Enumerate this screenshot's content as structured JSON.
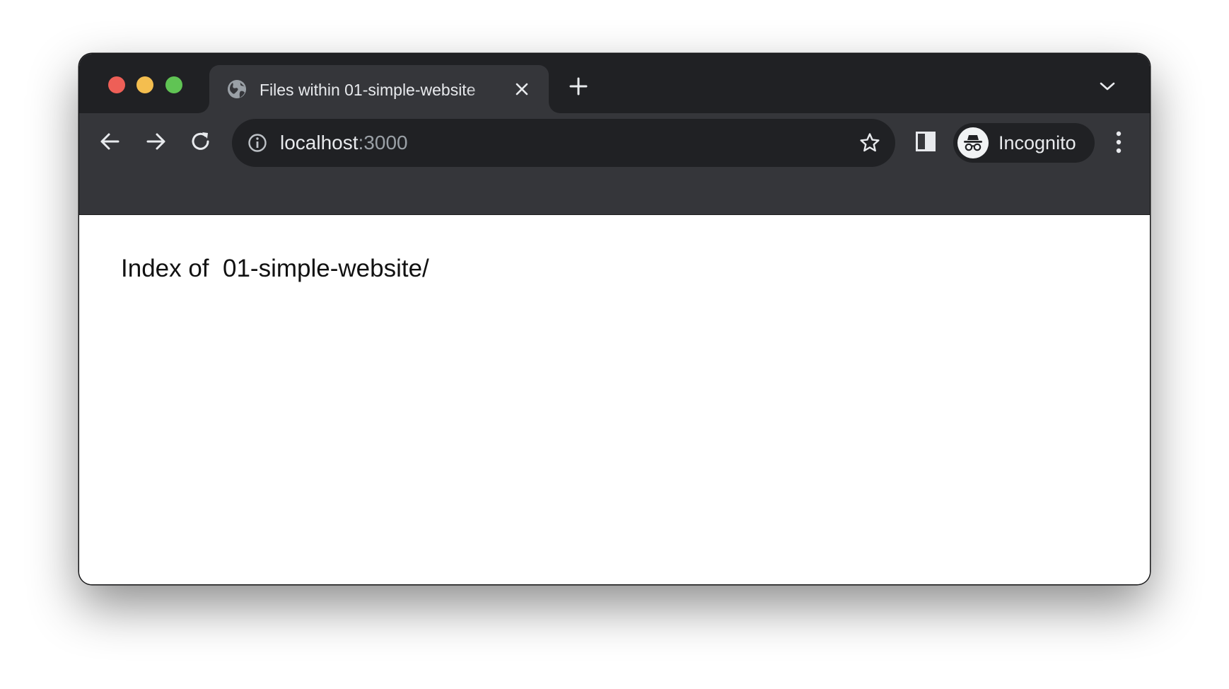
{
  "window": {
    "traffic_lights": {
      "close_color": "#ee5f57",
      "minimize_color": "#f4be4f",
      "maximize_color": "#60c454"
    }
  },
  "tabs": [
    {
      "title": "Files within 01-simple-website",
      "favicon": "globe-icon",
      "close_icon": "close-icon",
      "active": true
    }
  ],
  "tabstrip": {
    "new_tab_icon": "plus-icon",
    "tab_search_icon": "chevron-down-icon"
  },
  "toolbar": {
    "back_icon": "arrow-left-icon",
    "forward_icon": "arrow-right-icon",
    "reload_icon": "reload-icon",
    "side_panel_icon": "side-panel-icon",
    "menu_icon": "kebab-menu-icon"
  },
  "omnibox": {
    "site_info_icon": "info-icon",
    "url_host": "localhost",
    "url_port": ":3000",
    "bookmark_icon": "star-icon"
  },
  "profile": {
    "avatar_icon": "incognito-icon",
    "label": "Incognito"
  },
  "page": {
    "heading": "Index of  01-simple-website/"
  },
  "colors": {
    "tabstrip_bg": "#202124",
    "toolbar_bg": "#35363a",
    "omnibox_bg": "#202124",
    "text_primary": "#e8eaed",
    "text_secondary": "#9aa0a6",
    "content_bg": "#ffffff"
  }
}
